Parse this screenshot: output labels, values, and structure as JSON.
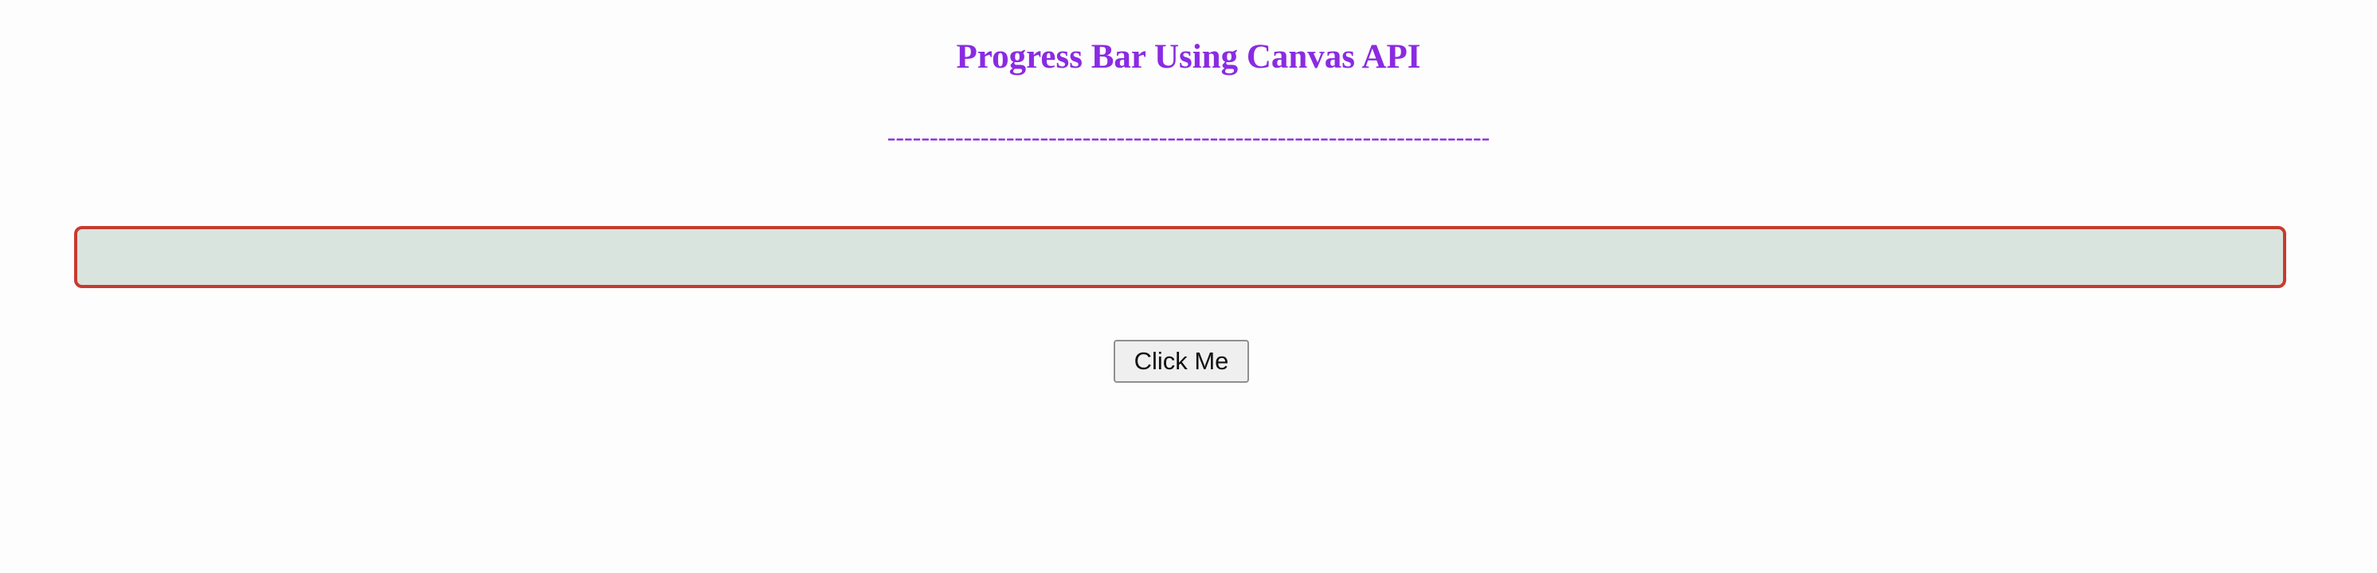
{
  "page": {
    "title": "Progress Bar Using Canvas API",
    "divider": "-----------------------------------------------------------------------"
  },
  "progress": {
    "value_fraction": 0,
    "track_color": "#d9e4de",
    "border_color": "#c83a2f",
    "fill_color": "#2e8b57"
  },
  "button": {
    "label": "Click Me"
  },
  "colors": {
    "heading": "#8a2be2",
    "background": "#fdfdfd"
  }
}
